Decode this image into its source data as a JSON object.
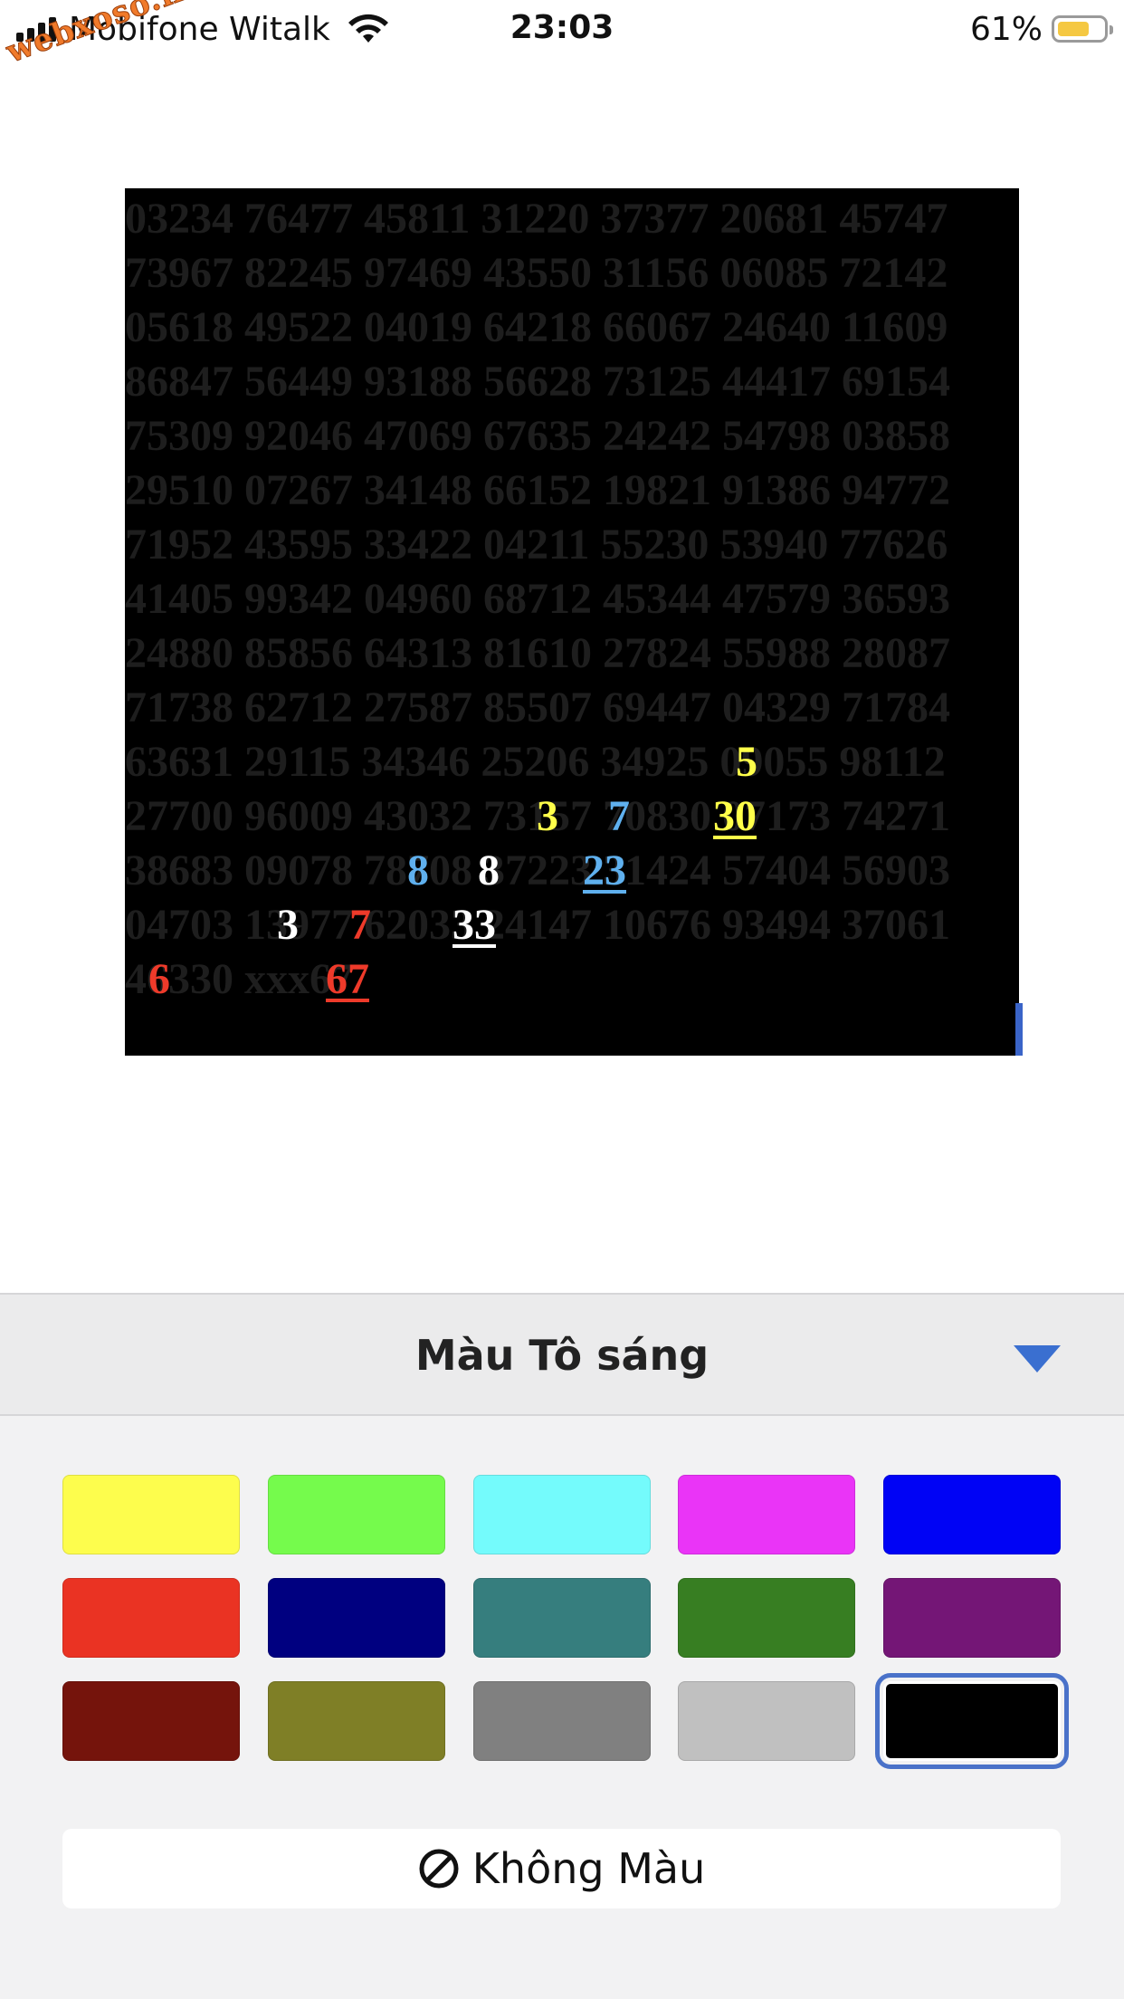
{
  "status_bar": {
    "carrier": "Mobifone Witalk",
    "time": "23:03",
    "battery": "61%",
    "battery_level": 0.61
  },
  "watermark": "webxoso.net",
  "board": {
    "rows": [
      "03234 76477 45811 31220 37377 20681 45747",
      "73967 82245 97469 43550 31156 06085 72142",
      "05618 49522 04019 64218 66067 24640 11609",
      "86847 56449 93188 56628 73125 44417 69154",
      "75309 92046 47069 67635 24242 54798 03858",
      "29510 07267 34148 66152 19821 91386 94772",
      "71952 43595 33422 04211 55230 53940 77626",
      "41405 99342 04960 68712 45344 47579 36593",
      "24880 85856 64313 81610 27824 55988 28087",
      "71738 62712 27587 85507 69447 04329 71784",
      "63631 29115 34346 25206 34925 09055 98112",
      "27700 96009 43032 73157 70830 07173 74271",
      "38683 09078 78708 37223 31424 57404 56903",
      "04703 13977 62033 24147 10676 93494 37061",
      "46330 xxx67"
    ],
    "highlights": {
      "r11_5": "5",
      "r12_3": "3",
      "r12_7": "7",
      "r12_30": "30",
      "r13_8a": "8",
      "r13_8b": "8",
      "r13_23": "23",
      "r14_3": "3",
      "r14_7": "7",
      "r14_33": "33",
      "r15_6": "6",
      "r15_67": "67"
    },
    "highlight_colors": {
      "yellow": "#ffff4a",
      "blue": "#5fb0ee",
      "white": "#ffffff",
      "red": "#ee3a2a"
    }
  },
  "sheet": {
    "title": "Màu Tô sáng",
    "no_color_label": "Không Màu",
    "swatches": [
      {
        "name": "yellow",
        "color": "#fdfd4d"
      },
      {
        "name": "green",
        "color": "#75fb4c"
      },
      {
        "name": "cyan",
        "color": "#74fbfc"
      },
      {
        "name": "magenta",
        "color": "#ea34f7"
      },
      {
        "name": "blue",
        "color": "#0003f5"
      },
      {
        "name": "red",
        "color": "#ea3323"
      },
      {
        "name": "navy",
        "color": "#000080"
      },
      {
        "name": "teal",
        "color": "#367e7e"
      },
      {
        "name": "dark-green",
        "color": "#377e22"
      },
      {
        "name": "purple",
        "color": "#741676"
      },
      {
        "name": "maroon",
        "color": "#75140c"
      },
      {
        "name": "olive",
        "color": "#7f7f26"
      },
      {
        "name": "gray",
        "color": "#808080"
      },
      {
        "name": "silver",
        "color": "#c0c0c0"
      },
      {
        "name": "black",
        "color": "#000000",
        "selected": true
      }
    ]
  }
}
